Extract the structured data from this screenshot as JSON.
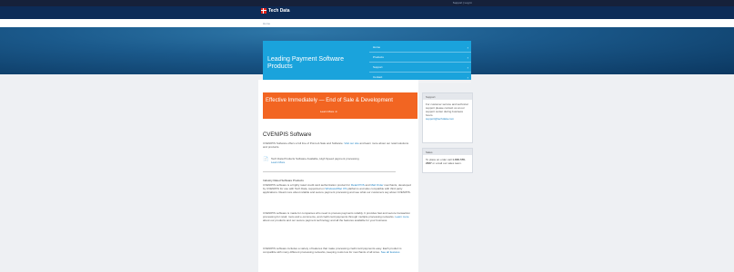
{
  "topbar": {
    "links": "Support | Log In"
  },
  "brand": {
    "name": "Tech Data"
  },
  "breadcrumb": "Home",
  "hero": {
    "title": "Leading Payment Software Products",
    "nav": [
      "Home",
      "Products",
      "Support",
      "Contact"
    ]
  },
  "banner": {
    "text": "Effective Immediately — End of Sale & Development",
    "button": "Learn More"
  },
  "main": {
    "heading": "CVENIPIS Software",
    "intro_1": "CVENIPIS Software offers a full line of Point-of-Sale and Software.",
    "intro_link": "Visit our site",
    "intro_2": "and learn more about our retail solutions and products.",
    "notice_1": "Tech Data Products Software Available, High Speed payment processing",
    "notice_link": "Learn More",
    "sub_heading": "Industry Rated Software Products",
    "p1_a": "CVENIPIS software is a highly rated credit card authorization product for",
    "p1_link1": "Retail POS",
    "p1_b": "and",
    "p1_link2": "Mail Order",
    "p1_c": "merchants, developed by CVENIPIS for use with Tech Data, supported on",
    "p1_link3": "Windows/Mac OS",
    "p1_d": "platforms and also compatible with third party applications. Read more about reliable and secure payment processing and see what our customers say about CVENIPIS.",
    "p2_a": "CVENIPIS software is made for companies who need to process payments reliably. It provides fast and secure transaction processing for retail, moto and e-commerce, and credit card payments through multiple processing networks.",
    "p2_link": "Learn more",
    "p2_b": "about our products and our secure payment technology and all the features available for your business.",
    "p3_a": "CVENIPIS software includes a variety of features that make processing credit card payments easy. Each product is compatible with many different processing networks, keeping costs low for merchants of all sizes.",
    "p3_link": "See all features"
  },
  "sidebar": {
    "box1_title": "Support",
    "box1_text": "For customer service and technical support please contact us at our support center during business hours.",
    "box1_link": "support@techdata.com",
    "box2_title": "Sales",
    "box2_text": "To place an order call",
    "box2_phone": "1-800-555-2687",
    "box2_after": "or email our sales team."
  },
  "colors": {
    "hero_box": "#1aa3dc",
    "banner": "#f26522",
    "brand_bar": "#0d2c57",
    "link": "#1a7fc1"
  },
  "icons": {
    "notice": "document-icon",
    "nav": "chevron-right-icon",
    "logo": "tech-data-logo-icon"
  }
}
